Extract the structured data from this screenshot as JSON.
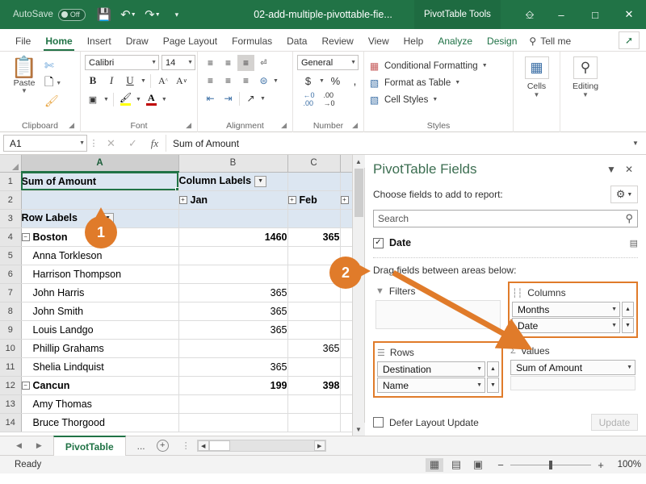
{
  "titlebar": {
    "autosave_label": "AutoSave",
    "autosave_state": "Off",
    "save_icon": "save-icon",
    "undo_icon": "undo-icon",
    "redo_icon": "redo-icon",
    "customize_icon": "customize-quick-access-icon",
    "document_title": "02-add-multiple-pivottable-fie...",
    "context_tab": "PivotTable Tools",
    "ribbon_display_icon": "ribbon-display-options-icon",
    "minimize_icon": "minimize-icon",
    "maximize_icon": "maximize-icon",
    "close_icon": "close-icon",
    "bg_color": "#217346",
    "context_bg_color": "#1e6b41"
  },
  "ribbon_tabs": {
    "tabs": [
      {
        "label": "File",
        "active": false,
        "contextual": false
      },
      {
        "label": "Home",
        "active": true,
        "contextual": false
      },
      {
        "label": "Insert",
        "active": false,
        "contextual": false
      },
      {
        "label": "Draw",
        "active": false,
        "contextual": false
      },
      {
        "label": "Page Layout",
        "active": false,
        "contextual": false
      },
      {
        "label": "Formulas",
        "active": false,
        "contextual": false
      },
      {
        "label": "Data",
        "active": false,
        "contextual": false
      },
      {
        "label": "Review",
        "active": false,
        "contextual": false
      },
      {
        "label": "View",
        "active": false,
        "contextual": false
      },
      {
        "label": "Help",
        "active": false,
        "contextual": false
      },
      {
        "label": "Analyze",
        "active": false,
        "contextual": true
      },
      {
        "label": "Design",
        "active": false,
        "contextual": true
      }
    ],
    "tellme_label": "Tell me",
    "tellme_icon": "search-icon",
    "share_icon": "share-icon",
    "accent_color": "#217346"
  },
  "ribbon": {
    "clipboard": {
      "title": "Clipboard",
      "paste_label": "Paste",
      "paste_icon": "paste-icon",
      "cut_icon": "scissors-icon",
      "copy_icon": "copy-icon",
      "format_painter_icon": "format-painter-icon"
    },
    "font": {
      "title": "Font",
      "font_name": "Calibri",
      "font_size": "14",
      "bold_label": "B",
      "italic_label": "I",
      "underline_label": "U",
      "grow_font_icon": "grow-font-icon",
      "shrink_font_icon": "shrink-font-icon",
      "borders_icon": "borders-icon",
      "fill_color_icon": "fill-color-icon",
      "font_color_icon": "font-color-icon",
      "fill_color": "#ffff00",
      "font_color": "#c00000"
    },
    "alignment": {
      "title": "Alignment",
      "align_top_icon": "align-top-icon",
      "align_middle_icon": "align-middle-icon",
      "align_bottom_icon": "align-bottom-icon",
      "wrap_text_icon": "wrap-text-icon",
      "align_left_icon": "align-left-icon",
      "align_center_icon": "align-center-icon",
      "align_right_icon": "align-right-icon",
      "merge_icon": "merge-and-center-icon",
      "decrease_indent_icon": "decrease-indent-icon",
      "increase_indent_icon": "increase-indent-icon",
      "orientation_icon": "orientation-icon"
    },
    "number": {
      "title": "Number",
      "format": "General",
      "currency_icon": "currency-icon",
      "percent_icon": "percent-icon",
      "comma_icon": "comma-style-icon",
      "increase_decimal_icon": "increase-decimal-icon",
      "decrease_decimal_icon": "decrease-decimal-icon"
    },
    "styles": {
      "title": "Styles",
      "items": [
        {
          "label": "Conditional Formatting",
          "icon": "conditional-formatting-icon"
        },
        {
          "label": "Format as Table",
          "icon": "format-as-table-icon"
        },
        {
          "label": "Cell Styles",
          "icon": "cell-styles-icon"
        }
      ]
    },
    "cells": {
      "label": "Cells",
      "icon": "cells-icon"
    },
    "editing": {
      "label": "Editing",
      "icon": "editing-find-icon"
    }
  },
  "formulabar": {
    "name_box_value": "A1",
    "cancel_icon": "cancel-icon",
    "enter_icon": "enter-icon",
    "function_icon": "insert-function-icon",
    "formula_value": "Sum of Amount",
    "expand_icon": "expand-formula-bar-icon"
  },
  "grid": {
    "columns": [
      "A",
      "B",
      "C"
    ],
    "selected_column": "A",
    "rows": [
      {
        "num": "1",
        "a": "Sum of Amount",
        "b": "Column Labels",
        "c": "",
        "a_style": "hdr-selected",
        "b_style": "hdr-filter",
        "c_style": "hdr"
      },
      {
        "num": "2",
        "a": "",
        "b": "Jan",
        "c": "Feb",
        "a_style": "hdr",
        "b_style": "hdr-expand",
        "c_style": "hdr-expand"
      },
      {
        "num": "3",
        "a": "Row Labels",
        "b": "",
        "c": "",
        "a_style": "hdr-filter",
        "b_style": "hdr",
        "c_style": "hdr"
      },
      {
        "num": "4",
        "a": "Boston",
        "b": "1460",
        "c": "365",
        "a_style": "group-collapse",
        "b_style": "num-bold",
        "c_style": "num-bold"
      },
      {
        "num": "5",
        "a": "Anna Torkleson",
        "b": "",
        "c": "",
        "a_style": "indent",
        "b_style": "num",
        "c_style": "num"
      },
      {
        "num": "6",
        "a": "Harrison Thompson",
        "b": "",
        "c": "",
        "a_style": "indent",
        "b_style": "num",
        "c_style": "num"
      },
      {
        "num": "7",
        "a": "John Harris",
        "b": "365",
        "c": "",
        "a_style": "indent",
        "b_style": "num",
        "c_style": "num"
      },
      {
        "num": "8",
        "a": "John Smith",
        "b": "365",
        "c": "",
        "a_style": "indent",
        "b_style": "num",
        "c_style": "num"
      },
      {
        "num": "9",
        "a": "Louis Landgo",
        "b": "365",
        "c": "",
        "a_style": "indent",
        "b_style": "num",
        "c_style": "num"
      },
      {
        "num": "10",
        "a": "Phillip Grahams",
        "b": "",
        "c": "365",
        "a_style": "indent",
        "b_style": "num",
        "c_style": "num"
      },
      {
        "num": "11",
        "a": "Shelia Lindquist",
        "b": "365",
        "c": "",
        "a_style": "indent",
        "b_style": "num",
        "c_style": "num"
      },
      {
        "num": "12",
        "a": "Cancun",
        "b": "199",
        "c": "398",
        "a_style": "group-collapse",
        "b_style": "num-bold",
        "c_style": "num-bold"
      },
      {
        "num": "13",
        "a": "Amy Thomas",
        "b": "",
        "c": "",
        "a_style": "indent",
        "b_style": "num",
        "c_style": "num"
      },
      {
        "num": "14",
        "a": "Bruce Thorgood",
        "b": "",
        "c": "",
        "a_style": "indent",
        "b_style": "num",
        "c_style": "num"
      }
    ],
    "filter_icon": "filter-dropdown-icon",
    "collapse_icon": "collapse-minus-icon",
    "expand_icon": "expand-plus-icon"
  },
  "panel": {
    "title": "PivotTable Fields",
    "dropdown_icon": "panel-menu-icon",
    "close_icon": "close-icon",
    "choose_label": "Choose fields to add to report:",
    "gear_icon": "gear-icon",
    "search_placeholder": "Search",
    "search_value": "",
    "search_icon": "search-icon",
    "fields": [
      {
        "name": "Date",
        "checked": true,
        "icon": "field-list-icon"
      }
    ],
    "drag_label": "Drag fields between areas below:",
    "areas": [
      {
        "id": "filters",
        "label": "Filters",
        "icon": "filter-funnel-icon",
        "highlighted": false,
        "items": []
      },
      {
        "id": "columns",
        "label": "Columns",
        "icon": "columns-icon",
        "highlighted": true,
        "items": [
          "Months",
          "Date"
        ]
      },
      {
        "id": "rows",
        "label": "Rows",
        "icon": "rows-icon",
        "highlighted": true,
        "items": [
          "Destination",
          "Name"
        ]
      },
      {
        "id": "values",
        "label": "Values",
        "icon": "sigma-icon",
        "highlighted": false,
        "items": [
          "Sum of Amount"
        ]
      }
    ],
    "defer_label": "Defer Layout Update",
    "defer_checked": false,
    "update_label": "Update",
    "update_enabled": false,
    "title_color": "#3c6e51",
    "highlight_color": "#e07b2a"
  },
  "sheetbar": {
    "prev_icon": "previous-sheet-icon",
    "next_icon": "next-sheet-icon",
    "tabs": [
      {
        "label": "PivotTable",
        "active": true
      }
    ],
    "ellipsis": "...",
    "add_sheet_icon": "add-sheet-icon",
    "scroll_left_icon": "scroll-left-icon",
    "scroll_right_icon": "scroll-right-icon"
  },
  "statusbar": {
    "status_text": "Ready",
    "view_buttons": [
      {
        "icon": "normal-view-icon",
        "active": true
      },
      {
        "icon": "page-layout-view-icon",
        "active": false
      },
      {
        "icon": "page-break-view-icon",
        "active": false
      }
    ],
    "zoom_out_label": "−",
    "zoom_in_label": "+",
    "zoom_level": "100%"
  },
  "callouts": [
    {
      "number": "1",
      "target": "row-labels-cell",
      "direction": "up"
    },
    {
      "number": "2",
      "target": "date-field-checkbox",
      "direction": "right"
    }
  ]
}
